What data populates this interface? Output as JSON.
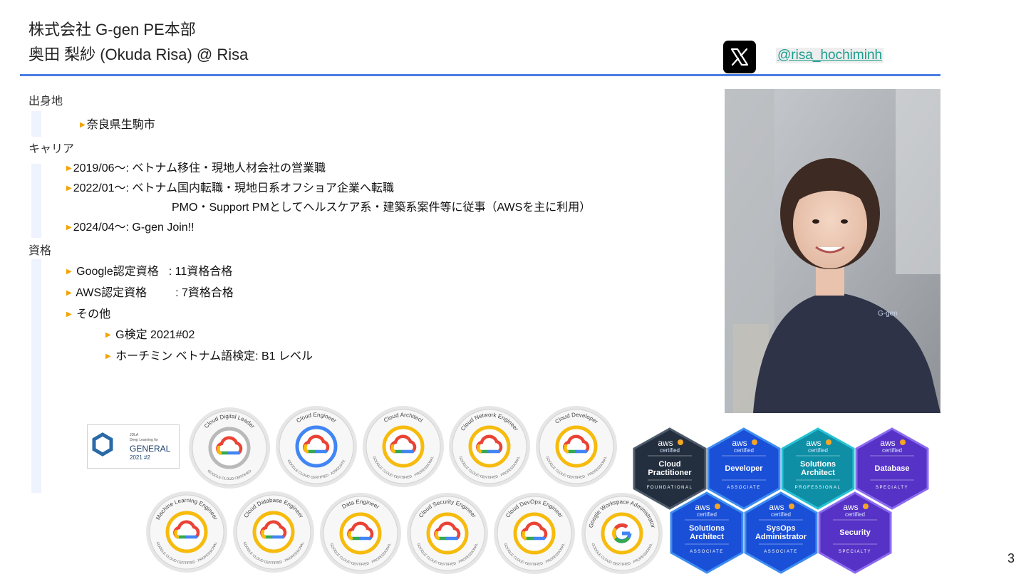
{
  "header": {
    "company": "株式会社 G-gen PE本部",
    "name": "奥田 梨紗 (Okuda Risa) @ Risa",
    "x_handle": "@risa_hochiminh"
  },
  "sections": {
    "hometown_label": "出身地",
    "hometown": "奈良県生駒市",
    "career_label": "キャリア",
    "career": [
      "2019/06〜: ベトナム移住・現地人材会社の営業職",
      "2022/01〜: ベトナム国内転職・現地日系オフショア企業へ転職",
      "PMO・Support PMとしてヘルスケア系・建築系案件等に従事（AWSを主に利用）",
      "2024/04〜: G-gen Join!!"
    ],
    "cert_label": "資格",
    "certs": {
      "google_label": "Google認定資格",
      "google_value": ": 11資格合格",
      "aws_label": "AWS認定資格",
      "aws_value": ": 7資格合格",
      "other_label": "その他",
      "other_items": [
        "G検定 2021#02",
        "ホーチミン ベトナム語検定: B1 レベル"
      ]
    }
  },
  "gkentei_badge": {
    "top": "JDLA",
    "sub": "Deep Learning for",
    "main": "GENERAL",
    "year": "2021 #2"
  },
  "google_badges": [
    {
      "name": "Cloud Digital Leader",
      "bottom": "GOOGLE CLOUD CERTIFIED",
      "ring": "#b9b9b9"
    },
    {
      "name": "Cloud Engineer",
      "bottom": "GOOGLE CLOUD CERTIFIED · ASSOCIATE",
      "ring": "#4285f4"
    },
    {
      "name": "Cloud Architect",
      "bottom": "GOOGLE CLOUD CERTIFIED · PROFESSIONAL",
      "ring": "#f6bb0d"
    },
    {
      "name": "Cloud Network Engineer",
      "bottom": "GOOGLE CLOUD CERTIFIED · PROFESSIONAL",
      "ring": "#f6bb0d"
    },
    {
      "name": "Cloud Developer",
      "bottom": "GOOGLE CLOUD CERTIFIED · PROFESSIONAL",
      "ring": "#f6bb0d"
    },
    {
      "name": "Machine Learning Engineer",
      "bottom": "GOOGLE CLOUD CERTIFIED · PROFESSIONAL",
      "ring": "#f6bb0d"
    },
    {
      "name": "Cloud Database Engineer",
      "bottom": "GOOGLE CLOUD CERTIFIED · PROFESSIONAL",
      "ring": "#f6bb0d"
    },
    {
      "name": "Data Engineer",
      "bottom": "GOOGLE CLOUD CERTIFIED · PROFESSIONAL",
      "ring": "#f6bb0d"
    },
    {
      "name": "Cloud Security Engineer",
      "bottom": "GOOGLE CLOUD CERTIFIED · PROFESSIONAL",
      "ring": "#f6bb0d"
    },
    {
      "name": "Cloud DevOps Engineer",
      "bottom": "GOOGLE CLOUD CERTIFIED · PROFESSIONAL",
      "ring": "#f6bb0d"
    },
    {
      "name": "Google Workspace Administrator",
      "bottom": "GOOGLE CLOUD CERTIFIED · PROFESSIONAL",
      "ring": "#f6bb0d"
    }
  ],
  "aws_badges": [
    {
      "line1": "Cloud",
      "line2": "Practitioner",
      "level": "FOUNDATIONAL",
      "color": "#232f3e",
      "stroke": "#4d5a6a"
    },
    {
      "line1": "Developer",
      "line2": "",
      "level": "ASSOCIATE",
      "color": "#1a4fd8",
      "stroke": "#3d8cf0"
    },
    {
      "line1": "Solutions",
      "line2": "Architect",
      "level": "PROFESSIONAL",
      "color": "#0e8fa6",
      "stroke": "#28c1d4"
    },
    {
      "line1": "Database",
      "line2": "",
      "level": "SPECIALTY",
      "color": "#5633c6",
      "stroke": "#8b6af0"
    },
    {
      "line1": "Solutions",
      "line2": "Architect",
      "level": "ASSOCIATE",
      "color": "#1a4fd8",
      "stroke": "#3d8cf0"
    },
    {
      "line1": "SysOps",
      "line2": "Administrator",
      "level": "ASSOCIATE",
      "color": "#1a4fd8",
      "stroke": "#3d8cf0"
    },
    {
      "line1": "Security",
      "line2": "",
      "level": "SPECIALTY",
      "color": "#5633c6",
      "stroke": "#8b6af0"
    }
  ],
  "aws_text": {
    "brand": "aws",
    "certified": "certified"
  },
  "page_number": "3"
}
